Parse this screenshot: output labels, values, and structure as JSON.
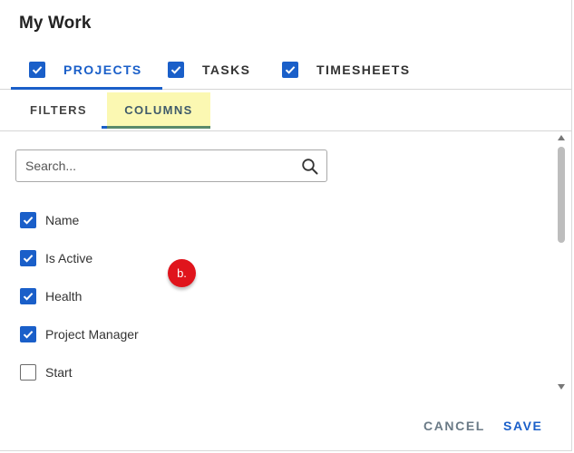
{
  "header": {
    "title": "My Work"
  },
  "top_tabs": [
    {
      "label": "PROJECTS",
      "checked": true,
      "active": true
    },
    {
      "label": "TASKS",
      "checked": true,
      "active": false
    },
    {
      "label": "TIMESHEETS",
      "checked": true,
      "active": false
    }
  ],
  "sub_tabs": [
    {
      "label": "FILTERS",
      "active": false
    },
    {
      "label": "COLUMNS",
      "active": true
    }
  ],
  "search": {
    "placeholder": "Search...",
    "value": ""
  },
  "columns": [
    {
      "label": "Name",
      "checked": true
    },
    {
      "label": "Is Active",
      "checked": true
    },
    {
      "label": "Health",
      "checked": true
    },
    {
      "label": "Project Manager",
      "checked": true
    },
    {
      "label": "Start",
      "checked": false
    }
  ],
  "badge": {
    "text": "b."
  },
  "footer": {
    "cancel_label": "CANCEL",
    "save_label": "SAVE"
  },
  "colors": {
    "accent": "#1a5fc9",
    "highlight": "#fbf8b2",
    "badge": "#e0141c"
  }
}
